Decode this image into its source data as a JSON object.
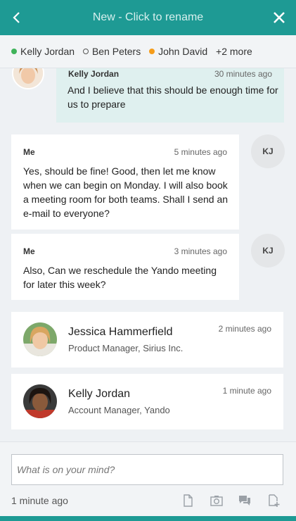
{
  "header": {
    "title": "New - Click to rename",
    "back_icon": "chevron-left-icon",
    "close_icon": "close-icon",
    "color": "#1e9a94"
  },
  "participants": [
    {
      "name": "Kelly Jordan",
      "status": "online"
    },
    {
      "name": "Ben Peters",
      "status": "offline"
    },
    {
      "name": "John David",
      "status": "away"
    }
  ],
  "participants_more": "+2 more",
  "messages": [
    {
      "sender": "Kelly Jordan",
      "time": "30 minutes ago",
      "text": "And I believe that this should be enough time for us to prepare"
    },
    {
      "sender": "Me",
      "time": "5 minutes ago",
      "text": "Yes, should be fine! Good, then let me know when we can begin on Monday. I will also book a meeting room for both teams. Shall I send an e-mail to everyone?",
      "avatar_initials": "KJ"
    },
    {
      "sender": "Me",
      "time": "3 minutes ago",
      "text": "Also, Can we reschedule the Yando meeting for later this week?",
      "avatar_initials": "KJ"
    }
  ],
  "contact_cards": [
    {
      "name": "Jessica Hammerfield",
      "role": "Product Manager, Sirius Inc.",
      "time": "2 minutes ago"
    },
    {
      "name": "Kelly Jordan",
      "role": "Account Manager, Yando",
      "time": "1 minute ago"
    }
  ],
  "composer": {
    "placeholder": "What is on your mind?",
    "value": "",
    "status": "1 minute ago",
    "tools": [
      "document-icon",
      "camera-icon",
      "chat-icon",
      "add-document-icon"
    ]
  },
  "colors": {
    "accent": "#1e9a94",
    "incoming_bubble": "#dff0ef",
    "online": "#3fb35a",
    "away": "#f59c1a"
  }
}
